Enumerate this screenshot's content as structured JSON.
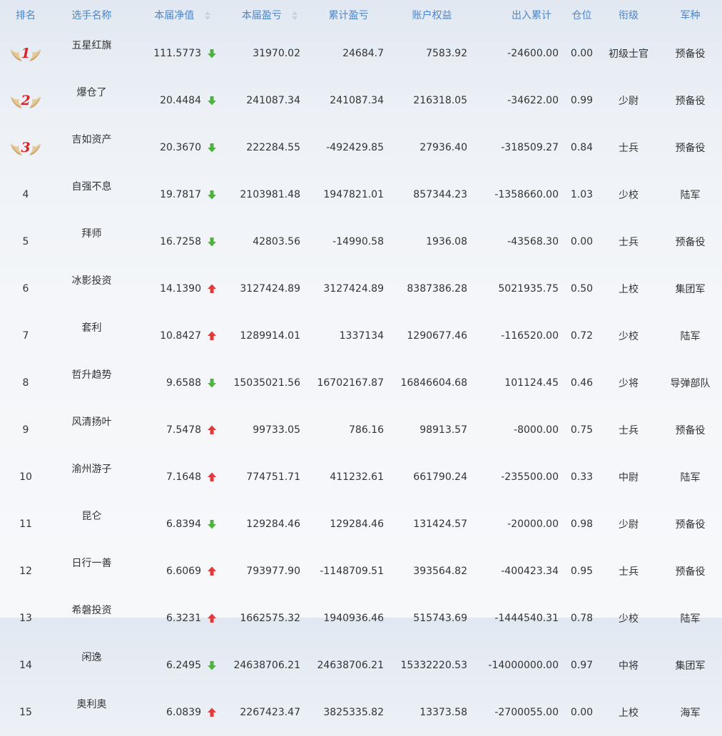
{
  "headers": {
    "rank": "排名",
    "name": "选手名称",
    "nav": "本届净值",
    "pnl": "本届盈亏",
    "cum_pnl": "累计盈亏",
    "equity": "账户权益",
    "flow": "出入累计",
    "position": "仓位",
    "title": "衔级",
    "branch": "军种"
  },
  "colors": {
    "header_text": "#4d86c8",
    "down_arrow": "#4bb43d",
    "up_arrow": "#e23a3a",
    "medal": "#d8232a"
  },
  "rows": [
    {
      "rank": "1",
      "medal": true,
      "name": "五星红旗",
      "nav": "111.5773",
      "trend": "down",
      "pnl": "31970.02",
      "cum_pnl": "24684.7",
      "equity": "7583.92",
      "flow": "-24600.00",
      "position": "0.00",
      "title": "初级士官",
      "branch": "预备役"
    },
    {
      "rank": "2",
      "medal": true,
      "name": "爆仓了",
      "nav": "20.4484",
      "trend": "down",
      "pnl": "241087.34",
      "cum_pnl": "241087.34",
      "equity": "216318.05",
      "flow": "-34622.00",
      "position": "0.99",
      "title": "少尉",
      "branch": "预备役"
    },
    {
      "rank": "3",
      "medal": true,
      "name": "吉如资产",
      "nav": "20.3670",
      "trend": "down",
      "pnl": "222284.55",
      "cum_pnl": "-492429.85",
      "equity": "27936.40",
      "flow": "-318509.27",
      "position": "0.84",
      "title": "士兵",
      "branch": "预备役"
    },
    {
      "rank": "4",
      "medal": false,
      "name": "自强不息",
      "nav": "19.7817",
      "trend": "down",
      "pnl": "2103981.48",
      "cum_pnl": "1947821.01",
      "equity": "857344.23",
      "flow": "-1358660.00",
      "position": "1.03",
      "title": "少校",
      "branch": "陆军"
    },
    {
      "rank": "5",
      "medal": false,
      "name": "拜师",
      "nav": "16.7258",
      "trend": "down",
      "pnl": "42803.56",
      "cum_pnl": "-14990.58",
      "equity": "1936.08",
      "flow": "-43568.30",
      "position": "0.00",
      "title": "士兵",
      "branch": "预备役"
    },
    {
      "rank": "6",
      "medal": false,
      "name": "冰影投资",
      "nav": "14.1390",
      "trend": "up",
      "pnl": "3127424.89",
      "cum_pnl": "3127424.89",
      "equity": "8387386.28",
      "flow": "5021935.75",
      "position": "0.50",
      "title": "上校",
      "branch": "集团军"
    },
    {
      "rank": "7",
      "medal": false,
      "name": "套利",
      "nav": "10.8427",
      "trend": "up",
      "pnl": "1289914.01",
      "cum_pnl": "1337134",
      "equity": "1290677.46",
      "flow": "-116520.00",
      "position": "0.72",
      "title": "少校",
      "branch": "陆军"
    },
    {
      "rank": "8",
      "medal": false,
      "name": "哲升趋势",
      "nav": "9.6588",
      "trend": "down",
      "pnl": "15035021.56",
      "cum_pnl": "16702167.87",
      "equity": "16846604.68",
      "flow": "101124.45",
      "position": "0.46",
      "title": "少将",
      "branch": "导弹部队"
    },
    {
      "rank": "9",
      "medal": false,
      "name": "风清扬叶",
      "nav": "7.5478",
      "trend": "up",
      "pnl": "99733.05",
      "cum_pnl": "786.16",
      "equity": "98913.57",
      "flow": "-8000.00",
      "position": "0.75",
      "title": "士兵",
      "branch": "预备役"
    },
    {
      "rank": "10",
      "medal": false,
      "name": "渝州游子",
      "nav": "7.1648",
      "trend": "up",
      "pnl": "774751.71",
      "cum_pnl": "411232.61",
      "equity": "661790.24",
      "flow": "-235500.00",
      "position": "0.33",
      "title": "中尉",
      "branch": "陆军"
    },
    {
      "rank": "11",
      "medal": false,
      "name": "昆仑",
      "nav": "6.8394",
      "trend": "down",
      "pnl": "129284.46",
      "cum_pnl": "129284.46",
      "equity": "131424.57",
      "flow": "-20000.00",
      "position": "0.98",
      "title": "少尉",
      "branch": "预备役"
    },
    {
      "rank": "12",
      "medal": false,
      "name": "日行一善",
      "nav": "6.6069",
      "trend": "up",
      "pnl": "793977.90",
      "cum_pnl": "-1148709.51",
      "equity": "393564.82",
      "flow": "-400423.34",
      "position": "0.95",
      "title": "士兵",
      "branch": "预备役"
    },
    {
      "rank": "13",
      "medal": false,
      "name": "希磐投资",
      "nav": "6.3231",
      "trend": "up",
      "pnl": "1662575.32",
      "cum_pnl": "1940936.46",
      "equity": "515743.69",
      "flow": "-1444540.31",
      "position": "0.78",
      "title": "少校",
      "branch": "陆军"
    },
    {
      "rank": "14",
      "medal": false,
      "name": "闲逸",
      "nav": "6.2495",
      "trend": "down",
      "pnl": "24638706.21",
      "cum_pnl": "24638706.21",
      "equity": "15332220.53",
      "flow": "-14000000.00",
      "position": "0.97",
      "title": "中将",
      "branch": "集团军"
    },
    {
      "rank": "15",
      "medal": false,
      "name": "奥利奥",
      "nav": "6.0839",
      "trend": "up",
      "pnl": "2267423.47",
      "cum_pnl": "3825335.82",
      "equity": "13373.58",
      "flow": "-2700055.00",
      "position": "0.00",
      "title": "上校",
      "branch": "海军"
    }
  ]
}
